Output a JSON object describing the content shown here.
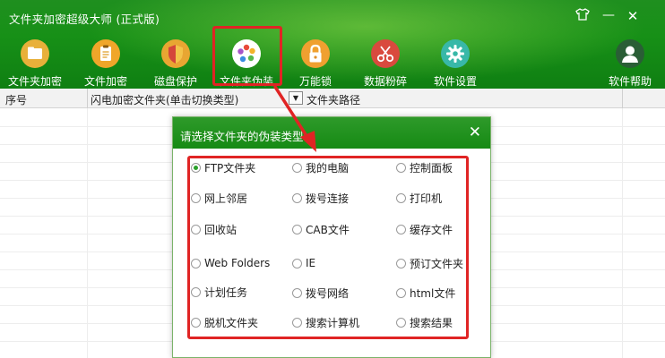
{
  "app": {
    "title": "文件夹加密超级大师 (正式版)",
    "brand_color": "#1a8f1a",
    "highlight_color": "#e02424"
  },
  "window_controls": {
    "skin_icon": "shirt-icon",
    "minimize_label": "—",
    "close_label": "✕"
  },
  "toolbar": [
    {
      "label": "文件夹加密",
      "icon": "folder-icon"
    },
    {
      "label": "文件加密",
      "icon": "clipboard-icon"
    },
    {
      "label": "磁盘保护",
      "icon": "shield-icon"
    },
    {
      "label": "文件夹伪装",
      "icon": "color-wheel-icon"
    },
    {
      "label": "万能锁",
      "icon": "lock-icon"
    },
    {
      "label": "数据粉碎",
      "icon": "scissors-icon"
    },
    {
      "label": "软件设置",
      "icon": "gear-icon"
    },
    {
      "label": "软件帮助",
      "icon": "user-icon"
    }
  ],
  "table": {
    "columns": [
      "序号",
      "闪电加密文件夹(单击切换类型)",
      "文件夹路径"
    ],
    "dropdown_glyph": "▼"
  },
  "dialog": {
    "title": "请选择文件夹的伪装类型",
    "close_label": "✕",
    "options": [
      {
        "label": "FTP文件夹",
        "checked": true
      },
      {
        "label": "我的电脑",
        "checked": false
      },
      {
        "label": "控制面板",
        "checked": false
      },
      {
        "label": "网上邻居",
        "checked": false
      },
      {
        "label": "拨号连接",
        "checked": false
      },
      {
        "label": "打印机",
        "checked": false
      },
      {
        "label": "回收站",
        "checked": false
      },
      {
        "label": "CAB文件",
        "checked": false
      },
      {
        "label": "缓存文件",
        "checked": false
      },
      {
        "label": "Web Folders",
        "checked": false
      },
      {
        "label": "IE",
        "checked": false
      },
      {
        "label": "预订文件夹",
        "checked": false
      },
      {
        "label": "计划任务",
        "checked": false
      },
      {
        "label": "拨号网络",
        "checked": false
      },
      {
        "label": "html文件",
        "checked": false
      },
      {
        "label": "脱机文件夹",
        "checked": false
      },
      {
        "label": "搜索计算机",
        "checked": false
      },
      {
        "label": "搜索结果",
        "checked": false
      }
    ]
  }
}
